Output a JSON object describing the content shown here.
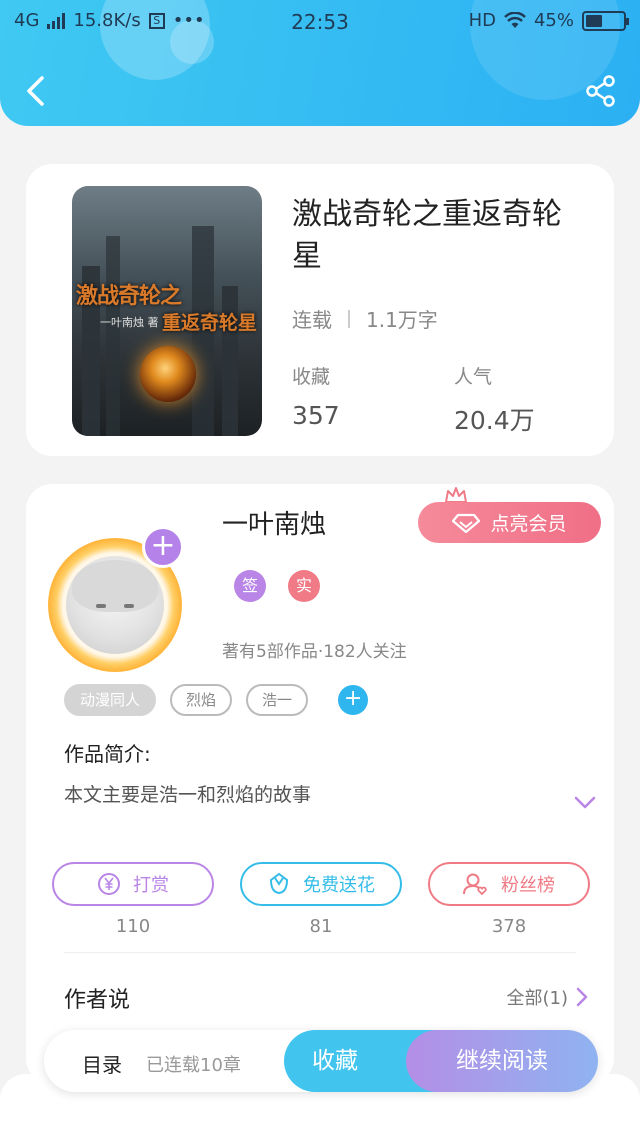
{
  "status_bar": {
    "network": "4G",
    "speed": "15.8K/s",
    "sim_icon": "S",
    "dots": "•••",
    "time": "22:53",
    "hd": "HD",
    "battery": "45%",
    "battery_level": 0.45
  },
  "header": {
    "back_icon": "chevron-left-icon",
    "share_icon": "share-icon"
  },
  "book": {
    "title": "激战奇轮之重返奇轮星",
    "status": "连载",
    "word_count": "1.1万字",
    "cover": {
      "text_main": "激战奇轮之",
      "text_author": "一叶南烛 著",
      "text_sub": "重返奇轮星"
    },
    "stats": [
      {
        "label": "收藏",
        "value": "357"
      },
      {
        "label": "人气",
        "value": "20.4万"
      }
    ]
  },
  "author": {
    "name": "一叶南烛",
    "vip_button": "点亮会员",
    "badges": [
      {
        "text": "签",
        "color": "#b985e6"
      },
      {
        "text": "实",
        "color": "#f07b86"
      }
    ],
    "works_info": "著有5部作品·182人关注"
  },
  "tags": [
    "动漫同人",
    "烈焰",
    "浩一"
  ],
  "intro": {
    "title": "作品简介:",
    "text": "本文主要是浩一和烈焰的故事"
  },
  "actions": [
    {
      "label": "打赏",
      "count": "110",
      "color": "#b985e6",
      "icon": "yen-coin-icon"
    },
    {
      "label": "免费送花",
      "count": "81",
      "color": "#35bde9",
      "icon": "flower-icon"
    },
    {
      "label": "粉丝榜",
      "count": "378",
      "color": "#f07b86",
      "icon": "fan-user-icon"
    }
  ],
  "author_say": {
    "title": "作者说",
    "all_link": "全部(1)"
  },
  "bottom_bar": {
    "toc": "目录",
    "serial_info": "已连载10章",
    "favorite": "收藏",
    "continue_reading": "继续阅读"
  }
}
